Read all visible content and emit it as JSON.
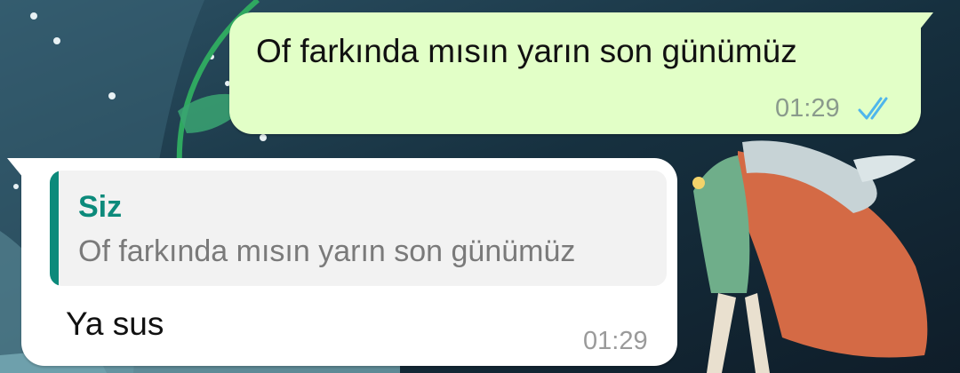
{
  "messages": {
    "outgoing": {
      "text": "Of farkında mısın yarın son günümüz",
      "time": "01:29",
      "status_icon": "double-check-read-icon"
    },
    "incoming": {
      "quote": {
        "author": "Siz",
        "text": "Of farkında mısın yarın son günümüz"
      },
      "text": "Ya sus",
      "time": "01:29"
    }
  },
  "colors": {
    "outgoing_bubble": "#e2ffc7",
    "incoming_bubble": "#ffffff",
    "quote_accent": "#0c8a7b",
    "read_ticks": "#4fb6ec",
    "wallpaper": "#1c3a4e"
  }
}
